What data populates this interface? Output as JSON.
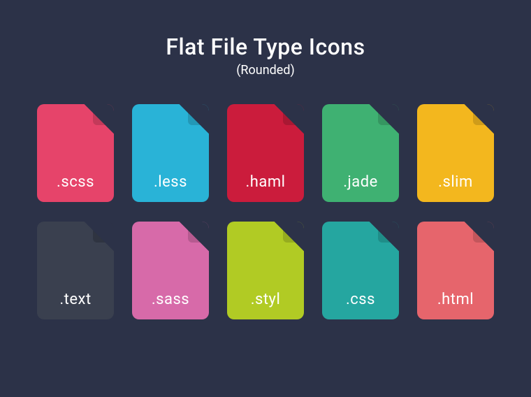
{
  "header": {
    "title": "Flat File Type Icons",
    "subtitle": "(Rounded)"
  },
  "files": [
    {
      "label": ".scss",
      "name": "file-icon-scss",
      "bg": "#e6446a",
      "fold": "#c33a5a"
    },
    {
      "label": ".less",
      "name": "file-icon-less",
      "bg": "#29b3d7",
      "fold": "#2398b7"
    },
    {
      "label": ".haml",
      "name": "file-icon-haml",
      "bg": "#cb1c3c",
      "fold": "#a91833"
    },
    {
      "label": ".jade",
      "name": "file-icon-jade",
      "bg": "#3fb172",
      "fold": "#369661"
    },
    {
      "label": ".slim",
      "name": "file-icon-slim",
      "bg": "#f3b71e",
      "fold": "#cf9c1a"
    },
    {
      "label": ".text",
      "name": "file-icon-text",
      "bg": "#3a404f",
      "fold": "#2f3441"
    },
    {
      "label": ".sass",
      "name": "file-icon-sass",
      "bg": "#d76aa9",
      "fold": "#b65a90"
    },
    {
      "label": ".styl",
      "name": "file-icon-styl",
      "bg": "#b1cb24",
      "fold": "#96ac1f"
    },
    {
      "label": ".css",
      "name": "file-icon-css",
      "bg": "#25a6a0",
      "fold": "#1f8d88"
    },
    {
      "label": ".html",
      "name": "file-icon-html",
      "bg": "#e6656c",
      "fold": "#c3565c"
    }
  ]
}
